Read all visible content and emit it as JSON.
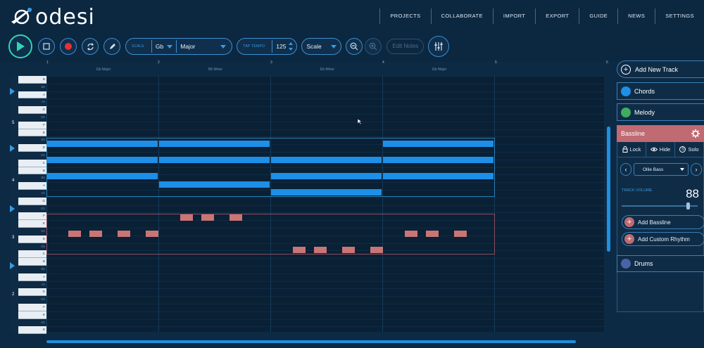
{
  "app": {
    "logo_text": "odesi"
  },
  "nav": {
    "items": [
      "PROJECTS",
      "COLLABORATE",
      "IMPORT",
      "EXPORT",
      "GUIDE",
      "NEWS",
      "SETTINGS"
    ]
  },
  "toolbar": {
    "scale_label": "SCALE",
    "key": "Gb",
    "mode": "Major",
    "tempo_label": "TAP TEMPO",
    "tempo": "125",
    "scale_mode": "Scale",
    "edit_notes": "Edit Notes"
  },
  "ruler": {
    "numbers": [
      "1",
      "2",
      "3",
      "4",
      "5",
      "6"
    ],
    "chords": [
      "Gb Major",
      "Bb Minor",
      "Eb Minor",
      "Gb Major"
    ]
  },
  "keys": {
    "rows": [
      "B",
      "Bb",
      "A",
      "Ab",
      "G",
      "Gb",
      "F",
      "E",
      "Eb",
      "D",
      "Db",
      "C",
      "B",
      "Bb",
      "A",
      "Ab",
      "G",
      "Gb",
      "F",
      "E",
      "Eb",
      "D",
      "Db",
      "C",
      "B",
      "Bb",
      "A",
      "Ab",
      "G",
      "Gb",
      "F",
      "E",
      "Eb",
      "D"
    ],
    "octaves": [
      "5",
      "4",
      "3",
      "2"
    ]
  },
  "panel": {
    "add_track": "Add New Track",
    "tracks": [
      {
        "name": "Chords",
        "color": "#1e90e6"
      },
      {
        "name": "Melody",
        "color": "#3fae5c"
      }
    ],
    "bassline": {
      "name": "Bassline",
      "lock": "Lock",
      "hide": "Hide",
      "solo": "Solo",
      "instrument": "Ollie Bass",
      "volume_label": "TRACK VOLUME",
      "volume": "88",
      "volume_fraction": 0.88,
      "add_bassline": "Add Bassline",
      "add_rhythm": "Add Custom Rhythm"
    },
    "drums": {
      "name": "Drums",
      "color": "#4a62a8"
    }
  },
  "colors": {
    "accent": "#1f8fe0",
    "bass": "#c06a72",
    "play": "#2fd6b0"
  }
}
